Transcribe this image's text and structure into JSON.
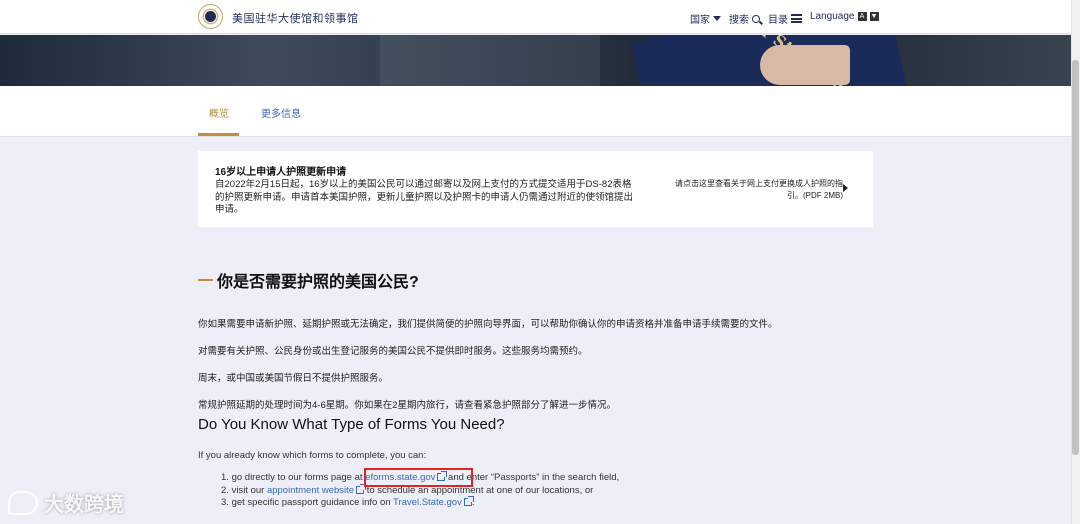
{
  "header": {
    "site_name": "美国驻华大使馆和领事馆",
    "nav_country": "国家",
    "nav_search": "搜索",
    "nav_menu": "目录",
    "nav_language": "Language",
    "lang_box_a": "A",
    "lang_box_b": "▼"
  },
  "hero": {
    "passport_text": "United St of Ame"
  },
  "tabs": [
    {
      "label": "概览",
      "active": true
    },
    {
      "label": "更多信息",
      "active": false
    }
  ],
  "notice": {
    "title": "16岁以上申请人护照更新申请",
    "body": "自2022年2月15日起，16岁以上的美国公民可以通过邮寄以及网上支付的方式提交适用于DS-82表格的护照更新申请。申请首本美国护照，更新儿童护照以及护照卡的申请人仍需通过附近的使领馆提出申请。",
    "link_text": "请点击这里查看关于网上支付更换成人护照的指引。(PDF 2MB)"
  },
  "main": {
    "heading": "你是否需要护照的美国公民?",
    "paragraphs": [
      "你如果需要申请新护照、延期护照或无法确定，我们提供简便的护照向导界面，可以帮助你确认你的申请资格并准备申请手续需要的文件。",
      "对需要有关护照、公民身份或出生登记服务的美国公民不提供即时服务。这些服务均需预约。",
      "周末，或中国或美国节假日不提供护照服务。",
      "常规护照延期的处理时间为4-6星期。你如果在2星期内旅行，请查看紧急护照部分了解进一步情况。"
    ],
    "forms_heading": "Do You Know What Type of Forms You Need?",
    "forms_intro": "If you already know which forms to complete, you can:",
    "list": [
      {
        "num": "1.",
        "pre": "go directly to our forms page at ",
        "link": "eforms.state.gov",
        "post": " and enter “Passports” in the search field,"
      },
      {
        "num": "2.",
        "pre": "visit our ",
        "link": "appointment website",
        "post": " to schedule an appointment at one of our locations, or"
      },
      {
        "num": "3.",
        "pre": "get specific passport guidance info on ",
        "link": "Travel.State.gov",
        "post": "."
      }
    ]
  },
  "watermark": {
    "text": "大数跨境"
  },
  "colors": {
    "accent": "#c2903a",
    "link": "#3a6ab0",
    "navy": "#1f2c5a",
    "highlight": "#e02424"
  }
}
